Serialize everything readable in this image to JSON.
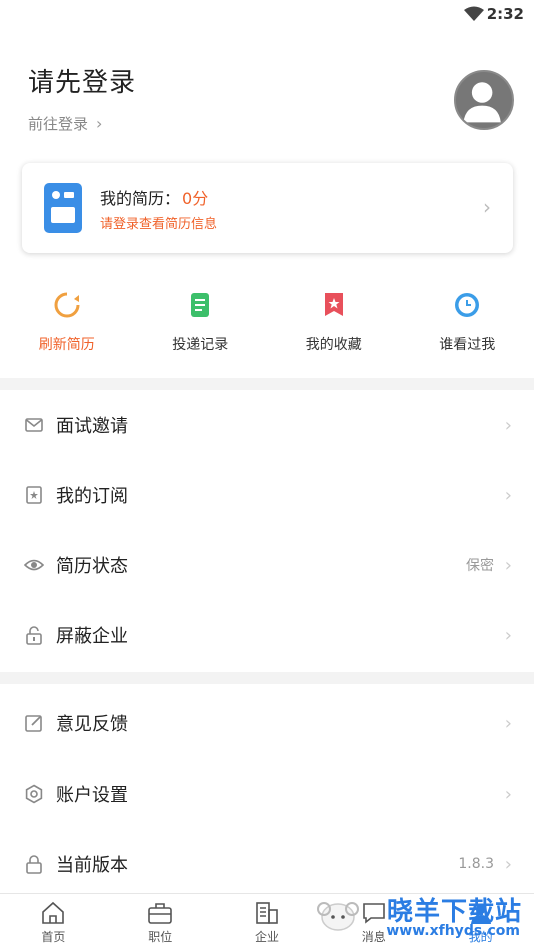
{
  "status_bar": {
    "time": "2:32"
  },
  "profile": {
    "title": "请先登录",
    "goto_label": "前往登录",
    "chev": "›"
  },
  "resume": {
    "label": "我的简历：",
    "score": "0分",
    "hint": "请登录查看简历信息",
    "chev": "›"
  },
  "quick_actions": [
    {
      "label": "刷新简历",
      "icon": "refresh-icon",
      "color": "#f0a040"
    },
    {
      "label": "投递记录",
      "icon": "document-icon",
      "color": "#3cbf6a"
    },
    {
      "label": "我的收藏",
      "icon": "bookmark-icon",
      "color": "#e8505b"
    },
    {
      "label": "谁看过我",
      "icon": "clock-icon",
      "color": "#3b9de8"
    }
  ],
  "menu_group1": [
    {
      "label": "面试邀请",
      "icon": "mail-icon",
      "value": ""
    },
    {
      "label": "我的订阅",
      "icon": "subscription-icon",
      "value": ""
    },
    {
      "label": "简历状态",
      "icon": "eye-icon",
      "value": "保密"
    },
    {
      "label": "屏蔽企业",
      "icon": "unlock-icon",
      "value": ""
    }
  ],
  "menu_group2": [
    {
      "label": "意见反馈",
      "icon": "edit-icon",
      "value": ""
    },
    {
      "label": "账户设置",
      "icon": "settings-icon",
      "value": ""
    },
    {
      "label": "当前版本",
      "icon": "lock-icon",
      "value": "1.8.3"
    }
  ],
  "tabbar": [
    {
      "label": "首页",
      "icon": "home-icon"
    },
    {
      "label": "职位",
      "icon": "briefcase-icon"
    },
    {
      "label": "企业",
      "icon": "building-icon"
    },
    {
      "label": "消息",
      "icon": "message-icon"
    },
    {
      "label": "我的",
      "icon": "user-icon"
    }
  ],
  "watermark": {
    "text": "晓羊下载站",
    "url": "www.xfhyds.com"
  },
  "colors": {
    "accent": "#f0622a",
    "active_tab": "#2a7de1",
    "separator": "#f3f3f3"
  }
}
